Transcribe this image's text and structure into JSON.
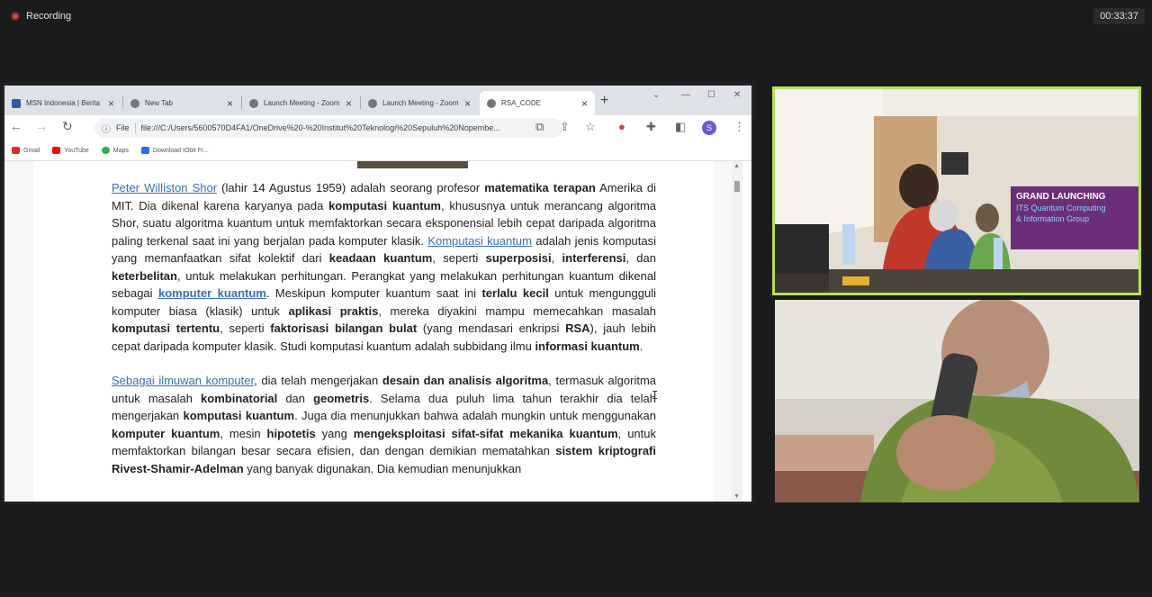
{
  "zoom": {
    "recording_label": "Recording",
    "timer": "00:33:37"
  },
  "browser": {
    "tabs": [
      {
        "title": "MSN Indonesia | Berita",
        "color": "#2a5aa8"
      },
      {
        "title": "New Tab",
        "color": "#555555"
      },
      {
        "title": "Launch Meeting - Zoom",
        "color": "#555555"
      },
      {
        "title": "Launch Meeting - Zoom",
        "color": "#555555"
      },
      {
        "title": "RSA_CODE",
        "color": "#555555",
        "active": true
      }
    ],
    "new_tab_icon": "+",
    "window_controls": [
      "⌄",
      "—",
      "☐",
      "✕"
    ],
    "address": {
      "info_icon": "ⓘ",
      "label": "File",
      "url": "file:///C:/Users/5600570D4FA1/OneDrive%20-%20Institut%20Teknologi%20Sepuluh%20Nopembe..."
    },
    "profile_initial": "S",
    "bookmarks": [
      {
        "label": "Gmail",
        "color": "#d93025"
      },
      {
        "label": "YouTube",
        "color": "#ff0000"
      },
      {
        "label": "Maps",
        "color": "#34a853"
      },
      {
        "label": "Download IObit Fr...",
        "color": "#1a73e8"
      }
    ]
  },
  "article": {
    "p1": [
      {
        "t": "Peter Williston Shor",
        "s": "link"
      },
      {
        "t": " (lahir 14 Agustus 1959) adalah seorang profesor "
      },
      {
        "t": "matematika terapan",
        "s": "bold"
      },
      {
        "t": " Amerika di MIT. Dia dikenal karena karyanya pada "
      },
      {
        "t": "komputasi kuantum",
        "s": "bold"
      },
      {
        "t": ", khususnya untuk merancang algoritma Shor, suatu algoritma kuantum untuk memfaktorkan secara eksponensial lebih cepat daripada algoritma paling terkenal saat ini yang berjalan pada komputer klasik. "
      },
      {
        "t": "Komputasi kuantum",
        "s": "link"
      },
      {
        "t": " adalah jenis komputasi yang memanfaatkan sifat kolektif dari "
      },
      {
        "t": "keadaan kuantum",
        "s": "bold"
      },
      {
        "t": ", seperti "
      },
      {
        "t": "superposisi",
        "s": "bold"
      },
      {
        "t": ", "
      },
      {
        "t": "interferensi",
        "s": "bold"
      },
      {
        "t": ", dan "
      },
      {
        "t": "keterbelitan",
        "s": "bold"
      },
      {
        "t": ", untuk melakukan perhitungan. Perangkat yang melakukan perhitungan kuantum dikenal sebagai "
      },
      {
        "t": "komputer kuantum",
        "s": "boldlink"
      },
      {
        "t": ". Meskipun komputer kuantum saat ini "
      },
      {
        "t": "terlalu kecil",
        "s": "bold"
      },
      {
        "t": " untuk mengungguli komputer biasa (klasik) untuk "
      },
      {
        "t": "aplikasi praktis",
        "s": "bold"
      },
      {
        "t": ", mereka diyakini mampu memecahkan masalah "
      },
      {
        "t": "komputasi tertentu",
        "s": "bold"
      },
      {
        "t": ", seperti "
      },
      {
        "t": "faktorisasi bilangan bulat",
        "s": "bold"
      },
      {
        "t": " (yang mendasari enkripsi "
      },
      {
        "t": "RSA",
        "s": "bold"
      },
      {
        "t": "), jauh lebih cepat daripada komputer klasik. Studi komputasi kuantum adalah subbidang ilmu "
      },
      {
        "t": "informasi kuantum",
        "s": "bold"
      },
      {
        "t": "."
      }
    ],
    "p2": [
      {
        "t": "Sebagai ilmuwan komputer",
        "s": "link"
      },
      {
        "t": ", dia telah mengerjakan "
      },
      {
        "t": "desain dan analisis algoritma",
        "s": "bold"
      },
      {
        "t": ", termasuk algoritma untuk masalah "
      },
      {
        "t": "kombinatorial",
        "s": "bold"
      },
      {
        "t": " dan "
      },
      {
        "t": "geometris",
        "s": "bold"
      },
      {
        "t": ". Selama dua puluh lima tahun terakhir dia telah mengerjakan "
      },
      {
        "t": "komputasi kuantum",
        "s": "bold"
      },
      {
        "t": ". Juga dia menunjukkan bahwa adalah mungkin untuk menggunakan "
      },
      {
        "t": "komputer kuantum",
        "s": "bold"
      },
      {
        "t": ", mesin "
      },
      {
        "t": "hipotetis",
        "s": "bold"
      },
      {
        "t": " yang "
      },
      {
        "t": "mengeksploitasi sifat-sifat mekanika kuantum",
        "s": "bold"
      },
      {
        "t": ", untuk memfaktorkan bilangan besar secara efisien, dan dengan demikian mematahkan "
      },
      {
        "t": "sistem kriptografi Rivest-Shamir-Adelman",
        "s": "bold"
      },
      {
        "t": " yang banyak digunakan. Dia kemudian menunjukkan"
      }
    ]
  },
  "video": {
    "banner_line1": "GRAND LAUNCHING",
    "banner_line2": "ITS Quantum Computing",
    "banner_line3": "& Information Group"
  }
}
